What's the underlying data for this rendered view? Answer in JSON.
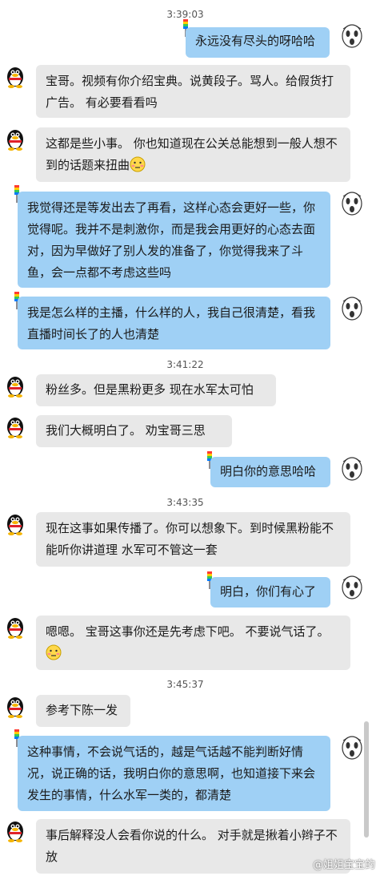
{
  "timestamps": [
    "3:39:03",
    "3:41:22",
    "3:43:35",
    "3:45:37"
  ],
  "messages": [
    {
      "text": "永远没有尽头的呀哈哈"
    },
    {
      "text": "宝哥。视频有你介绍宝典。说黄段子。骂人。给假货打广告。  有必要看看吗"
    },
    {
      "text": "这都是些小事。 你也知道现在公关总能想到一般人想不到的话题来扭曲"
    },
    {
      "text": "我觉得还是等发出去了再看，这样心态会更好一些，你觉得呢。我并不是刺激你，而是我会用更好的心态去面对，因为早做好了别人发的准备了，你觉得我来了斗鱼，会一点都不考虑这些吗"
    },
    {
      "text": "我是怎么样的主播，什么样的人，我自己很清楚，看我直播时间长了的人也清楚"
    },
    {
      "text": "粉丝多。但是黑粉更多 现在水军太可怕"
    },
    {
      "text": "我们大概明白了。  劝宝哥三思"
    },
    {
      "text": "明白你的意思哈哈"
    },
    {
      "text": "现在这事如果传播了。你可以想象下。到时候黑粉能不能听你讲道理 水军可不管这一套"
    },
    {
      "text": "明白，你们有心了"
    },
    {
      "text": "嗯嗯。 宝哥这事你还是先考虑下吧。 不要说气话了。"
    },
    {
      "text": "参考下陈一发"
    },
    {
      "text": "这种事情，不会说气话的，越是气话越不能判断好情况，说正确的话，我明白你的意思啊，也知道接下来会发生的事情，什么水军一类的，都清楚"
    },
    {
      "text": "事后解释没人会看你说的什么。 对手就是揪着小辫子不放"
    }
  ],
  "watermark": "@姐姐宝宝的",
  "icons": {
    "incoming_avatar": "penguin-avatar-icon",
    "outgoing_avatar": "scream-mask-avatar-icon",
    "emoji": "embarrassed-face-emoji",
    "flag": "colorful-flag-icon"
  },
  "colors": {
    "incoming_bubble": "#e8e8e8",
    "outgoing_bubble": "#9fd0f5",
    "background": "#ffffff"
  }
}
